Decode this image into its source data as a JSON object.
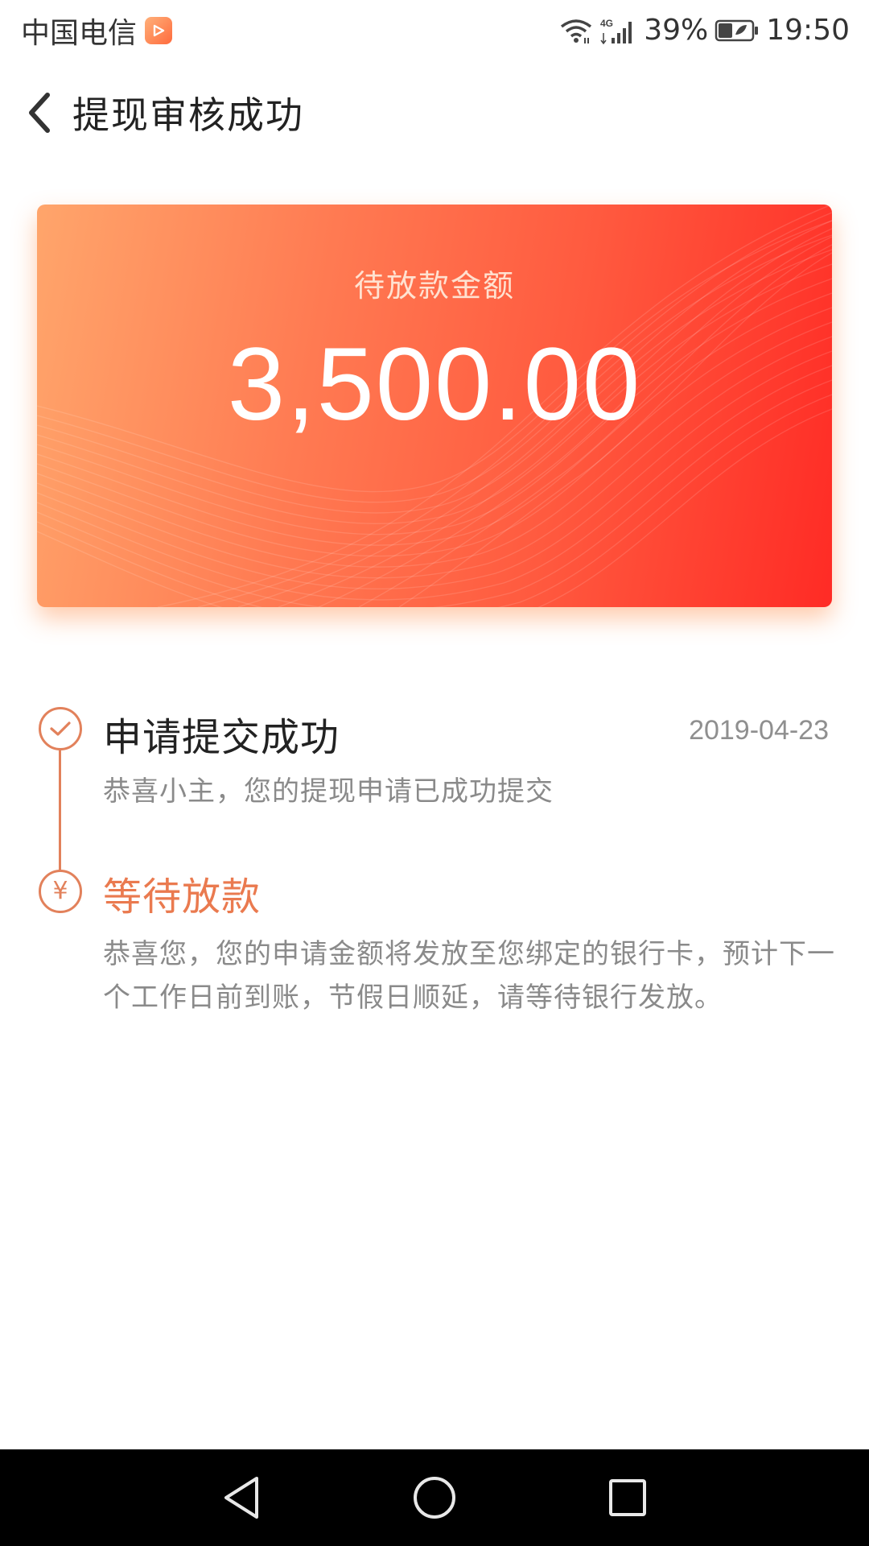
{
  "status_bar": {
    "carrier": "中国电信",
    "network": "4G",
    "battery": "39%",
    "time": "19:50"
  },
  "header": {
    "title": "提现审核成功"
  },
  "card": {
    "label": "待放款金额",
    "amount": "3,500.00"
  },
  "timeline": {
    "steps": [
      {
        "title": "申请提交成功",
        "date": "2019-04-23",
        "description": "恭喜小主，您的提现申请已成功提交"
      },
      {
        "title": "等待放款",
        "description": "恭喜您，您的申请金额将发放至您绑定的银行卡，预计下一个工作日前到账，节假日顺延，请等待银行发放。"
      }
    ]
  },
  "colors": {
    "accent": "#ea7a4f",
    "card_start": "#ffa56b",
    "card_end": "#ff2b25"
  }
}
